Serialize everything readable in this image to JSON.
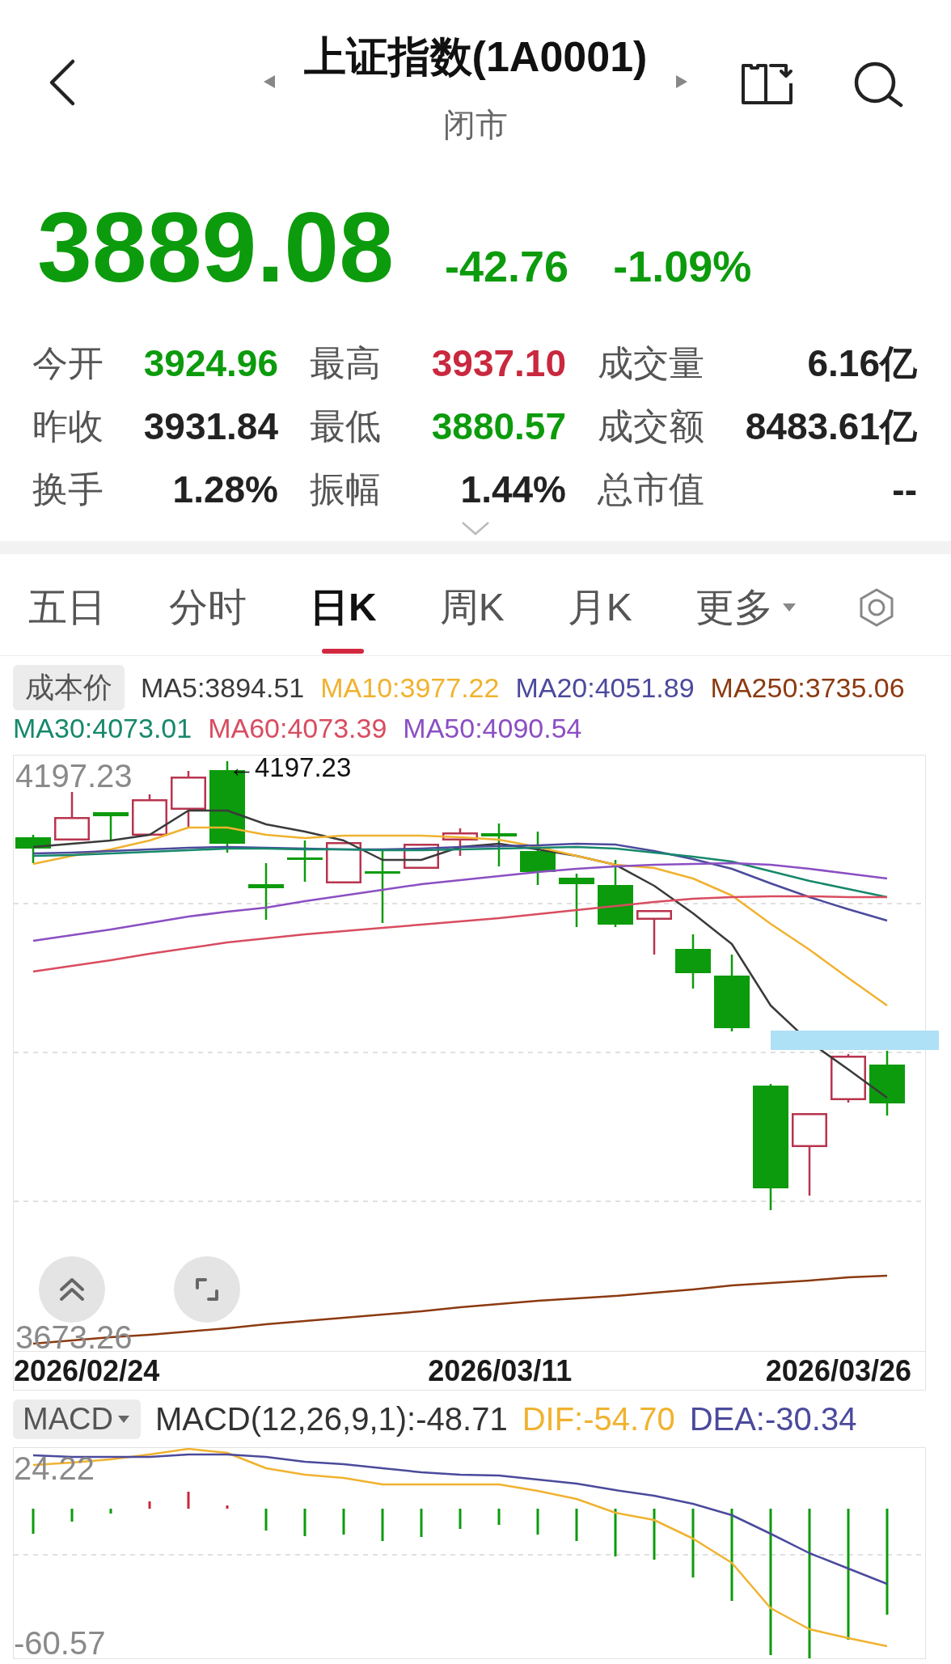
{
  "header": {
    "title": "上证指数(1A0001)",
    "status": "闭市"
  },
  "quote": {
    "price": "3889.08",
    "change": "-42.76",
    "change_percent": "-1.09%",
    "color": "#0c9b0c"
  },
  "stats": [
    {
      "label": "今开",
      "value": "3924.96",
      "color": "#0c9b0c"
    },
    {
      "label": "最高",
      "value": "3937.10",
      "color": "#c9283e"
    },
    {
      "label": "成交量",
      "value": "6.16亿",
      "color": "#222222"
    },
    {
      "label": "昨收",
      "value": "3931.84",
      "color": "#222222"
    },
    {
      "label": "最低",
      "value": "3880.57",
      "color": "#0c9b0c"
    },
    {
      "label": "成交额",
      "value": "8483.61亿",
      "color": "#222222"
    },
    {
      "label": "换手",
      "value": "1.28%",
      "color": "#222222"
    },
    {
      "label": "振幅",
      "value": "1.44%",
      "color": "#222222"
    },
    {
      "label": "总市值",
      "value": "--",
      "color": "#222222"
    }
  ],
  "tabs": [
    {
      "label": "五日",
      "selected": false,
      "kind": "tab"
    },
    {
      "label": "分时",
      "selected": false,
      "kind": "tab"
    },
    {
      "label": "日K",
      "selected": true,
      "kind": "tab"
    },
    {
      "label": "周K",
      "selected": false,
      "kind": "tab"
    },
    {
      "label": "月K",
      "selected": false,
      "kind": "tab"
    },
    {
      "label": "更多",
      "selected": false,
      "kind": "menu"
    }
  ],
  "kline": {
    "cost_button": "成本价",
    "ma_legend": [
      {
        "label": "MA5:3894.51",
        "color": "#3a3a3a"
      },
      {
        "label": "MA10:3977.22",
        "color": "#f0b22f"
      },
      {
        "label": "MA20:4051.89",
        "color": "#4b4a9c"
      },
      {
        "label": "MA250:3735.06",
        "color": "#8c3a10"
      },
      {
        "label": "MA30:4073.01",
        "color": "#16886b"
      },
      {
        "label": "MA60:4073.39",
        "color": "#d94c60"
      },
      {
        "label": "MA50:4090.54",
        "color": "#8b4fc3"
      }
    ],
    "y_max": "4197.23",
    "high_marker": "←4197.23",
    "y_min": "3673.26",
    "dates": [
      "2026/02/24",
      "2026/03/11",
      "2026/03/26"
    ]
  },
  "macd": {
    "selector": "MACD",
    "legend": [
      {
        "label": "MACD(12,26,9,1):-48.71",
        "color": "#333333"
      },
      {
        "label": "DIF:-54.70",
        "color": "#f0b22f"
      },
      {
        "label": "DEA:-30.34",
        "color": "#4b4a9c"
      }
    ],
    "y_max": "24.22",
    "y_min": "-60.57"
  }
}
